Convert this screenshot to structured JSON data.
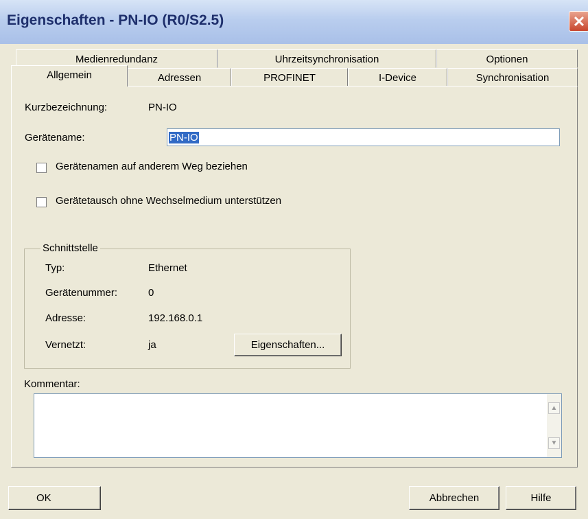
{
  "window": {
    "title": "Eigenschaften - PN-IO (R0/S2.5)",
    "close_glyph": "✕"
  },
  "tabs_back": [
    "Medienredundanz",
    "Uhrzeitsynchronisation",
    "Optionen"
  ],
  "tabs_front": [
    "Allgemein",
    "Adressen",
    "PROFINET",
    "I-Device",
    "Synchronisation"
  ],
  "active_tab": "Allgemein",
  "general": {
    "short_label": "Kurzbezeichnung:",
    "short_value": "PN-IO",
    "devname_label": "Gerätename:",
    "devname_value": "PN-IO",
    "cb1_label": "Gerätenamen auf anderem Weg beziehen",
    "cb1_checked": false,
    "cb2_label": "Gerätetausch ohne Wechselmedium unterstützen",
    "cb2_checked": false
  },
  "interface": {
    "legend": "Schnittstelle",
    "type_label": "Typ:",
    "type_value": "Ethernet",
    "devnum_label": "Gerätenummer:",
    "devnum_value": "0",
    "address_label": "Adresse:",
    "address_value": "192.168.0.1",
    "networked_label": "Vernetzt:",
    "networked_value": "ja",
    "properties_button": "Eigenschaften..."
  },
  "comment": {
    "label": "Kommentar:",
    "value": ""
  },
  "footer": {
    "ok": "OK",
    "cancel": "Abbrechen",
    "help": "Hilfe"
  },
  "colors": {
    "face": "#ECE9D8",
    "selection": "#316AC5",
    "title_text": "#1E2F6C"
  }
}
